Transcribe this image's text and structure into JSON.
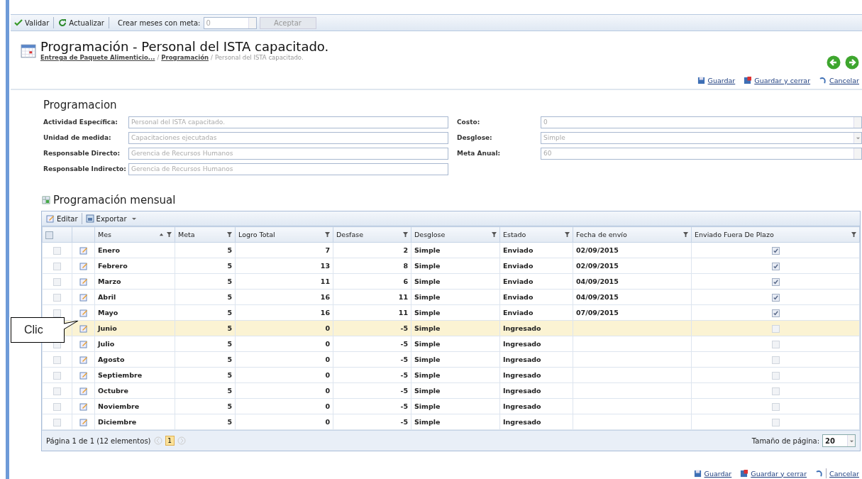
{
  "toolbar": {
    "validar": "Validar",
    "actualizar": "Actualizar",
    "crear_label": "Crear meses con meta:",
    "crear_value": "0",
    "aceptar": "Aceptar"
  },
  "header": {
    "title": "Programación - Personal del ISTA capacitado.",
    "separators": [
      "/",
      "/"
    ],
    "breadcrumb": [
      {
        "label": "Entrega de Paquete Alimenticio...",
        "link": true
      },
      {
        "label": "Programación",
        "link": true
      },
      {
        "label": "Personal del ISTA capacitado.",
        "link": false
      }
    ]
  },
  "actions_top": [
    "Guardar",
    "Guardar y cerrar",
    "Cancelar"
  ],
  "form": {
    "title": "Programacion",
    "left": [
      {
        "label": "Actividad Específica:",
        "value": "Personal del ISTA capacitado."
      },
      {
        "label": "Unidad de medida:",
        "value": "Capacitaciones ejecutadas"
      },
      {
        "label": "Responsable Directo:",
        "value": "Gerencia de Recursos Humanos"
      },
      {
        "label": "Responsable Indirecto:",
        "value": "Gerencia de Recursos Humanos"
      }
    ],
    "right": [
      {
        "label": "Costo:",
        "value": "0",
        "kind": "spinner"
      },
      {
        "label": "Desglose:",
        "value": "Simple",
        "kind": "dropdown"
      },
      {
        "label": "Meta Anual:",
        "value": "60",
        "kind": "spinner"
      }
    ]
  },
  "grid": {
    "title": "Programación mensual",
    "toolbar": [
      "Editar",
      "Exportar"
    ],
    "columns": [
      {
        "label": "Mes",
        "sorted": true
      },
      {
        "label": "Meta",
        "sorted": false
      },
      {
        "label": "Logro Total",
        "sorted": false
      },
      {
        "label": "Desfase",
        "sorted": false
      },
      {
        "label": "Desglose",
        "sorted": false
      },
      {
        "label": "Estado",
        "sorted": false
      },
      {
        "label": "Fecha de envío",
        "sorted": false
      },
      {
        "label": "Enviado Fuera De Plazo",
        "sorted": false
      }
    ],
    "select_all_checked": false,
    "rows": [
      {
        "mes": "Enero",
        "meta": "5",
        "logro": "7",
        "desfase": "2",
        "desglose": "Simple",
        "estado": "Enviado",
        "fecha": "02/09/2015",
        "fuera_plazo": true,
        "selected": false
      },
      {
        "mes": "Febrero",
        "meta": "5",
        "logro": "13",
        "desfase": "8",
        "desglose": "Simple",
        "estado": "Enviado",
        "fecha": "02/09/2015",
        "fuera_plazo": true,
        "selected": false
      },
      {
        "mes": "Marzo",
        "meta": "5",
        "logro": "11",
        "desfase": "6",
        "desglose": "Simple",
        "estado": "Enviado",
        "fecha": "04/09/2015",
        "fuera_plazo": true,
        "selected": false
      },
      {
        "mes": "Abril",
        "meta": "5",
        "logro": "16",
        "desfase": "11",
        "desglose": "Simple",
        "estado": "Enviado",
        "fecha": "04/09/2015",
        "fuera_plazo": true,
        "selected": false
      },
      {
        "mes": "Mayo",
        "meta": "5",
        "logro": "16",
        "desfase": "11",
        "desglose": "Simple",
        "estado": "Enviado",
        "fecha": "07/09/2015",
        "fuera_plazo": true,
        "selected": false
      },
      {
        "mes": "Junio",
        "row_checkbox_visible": false,
        "meta": "5",
        "logro": "0",
        "desfase": "-5",
        "desglose": "Simple",
        "estado": "Ingresado",
        "fuera_plazo": false,
        "selected": true
      },
      {
        "mes": "Julio",
        "meta": "5",
        "logro": "0",
        "desfase": "-5",
        "desglose": "Simple",
        "estado": "Ingresado",
        "fuera_plazo": false,
        "selected": false
      },
      {
        "mes": "Agosto",
        "meta": "5",
        "logro": "0",
        "desfase": "-5",
        "desglose": "Simple",
        "estado": "Ingresado",
        "fuera_plazo": false,
        "selected": false
      },
      {
        "mes": "Septiembre",
        "meta": "5",
        "logro": "0",
        "desfase": "-5",
        "desglose": "Simple",
        "estado": "Ingresado",
        "fuera_plazo": false,
        "selected": false
      },
      {
        "mes": "Octubre",
        "meta": "5",
        "logro": "0",
        "desfase": "-5",
        "desglose": "Simple",
        "estado": "Ingresado",
        "fuera_plazo": false,
        "selected": false
      },
      {
        "mes": "Noviembre",
        "meta": "5",
        "logro": "0",
        "desfase": "-5",
        "desglose": "Simple",
        "estado": "Ingresado",
        "fuera_plazo": false,
        "selected": false
      },
      {
        "mes": "Diciembre",
        "meta": "5",
        "logro": "0",
        "desfase": "-5",
        "desglose": "Simple",
        "estado": "Ingresado",
        "fuera_plazo": false,
        "selected": false
      }
    ],
    "pager": {
      "info": "Página 1 de 1 (12 elementos)",
      "page": "1",
      "size_label": "Tamaño de página:",
      "size": "20"
    }
  },
  "actions_bottom": [
    "Guardar",
    "Guardar y cerrar",
    "Cancelar"
  ],
  "callout": "Clic"
}
